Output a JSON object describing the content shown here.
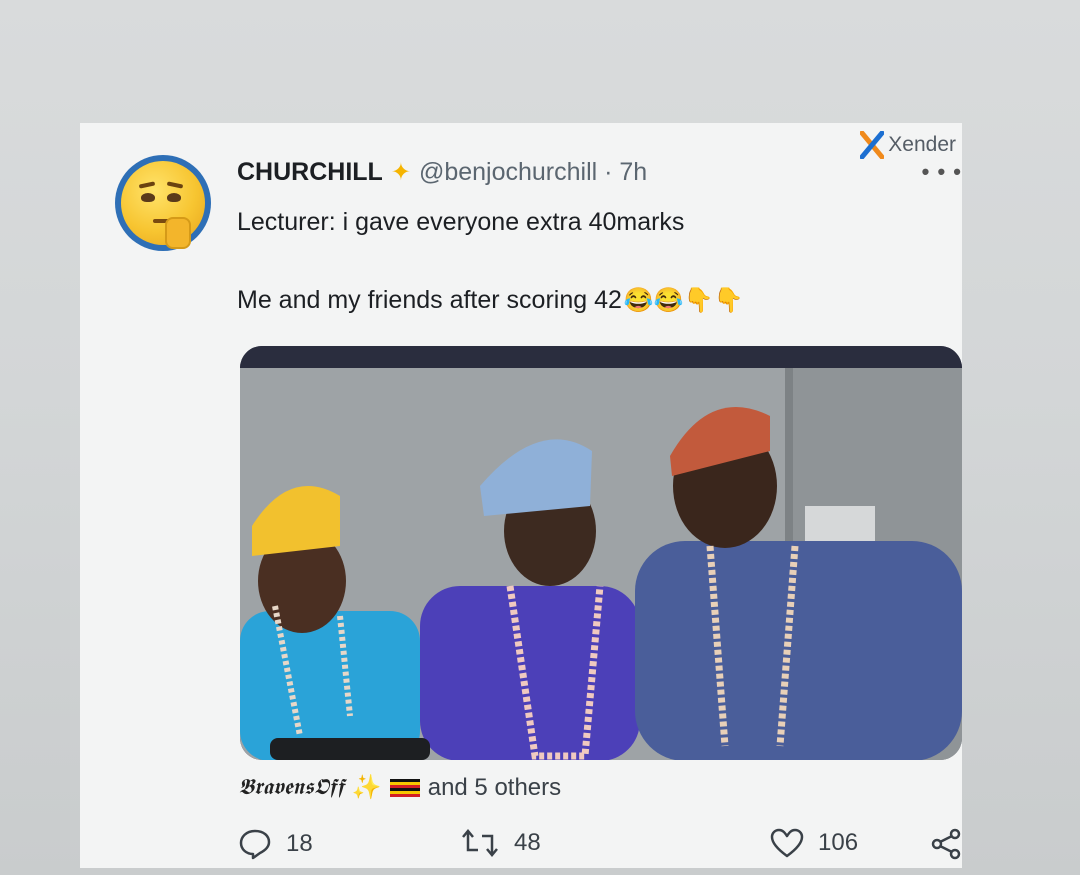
{
  "watermark": {
    "label": "Xender"
  },
  "tweet": {
    "display_name": "CHURCHILL",
    "handle_time": "@benjochurchill · 7h",
    "line1": "Lecturer: i gave everyone extra 40marks",
    "line2": "Me and my friends after scoring 42",
    "line2_emojis": "😂😂👇👇"
  },
  "likers": {
    "name": "𝕭𝖗𝖆𝖛𝖊𝖓𝖘𝕺𝖋𝖋",
    "emojis": "✨",
    "summary": "and 5 others"
  },
  "actions": {
    "replies": "18",
    "retweets": "48",
    "likes": "106"
  },
  "colors": {
    "card_bg": "#f3f4f4",
    "text": "#1c1f23",
    "muted": "#5b6670",
    "sparkle": "#f5b400"
  }
}
